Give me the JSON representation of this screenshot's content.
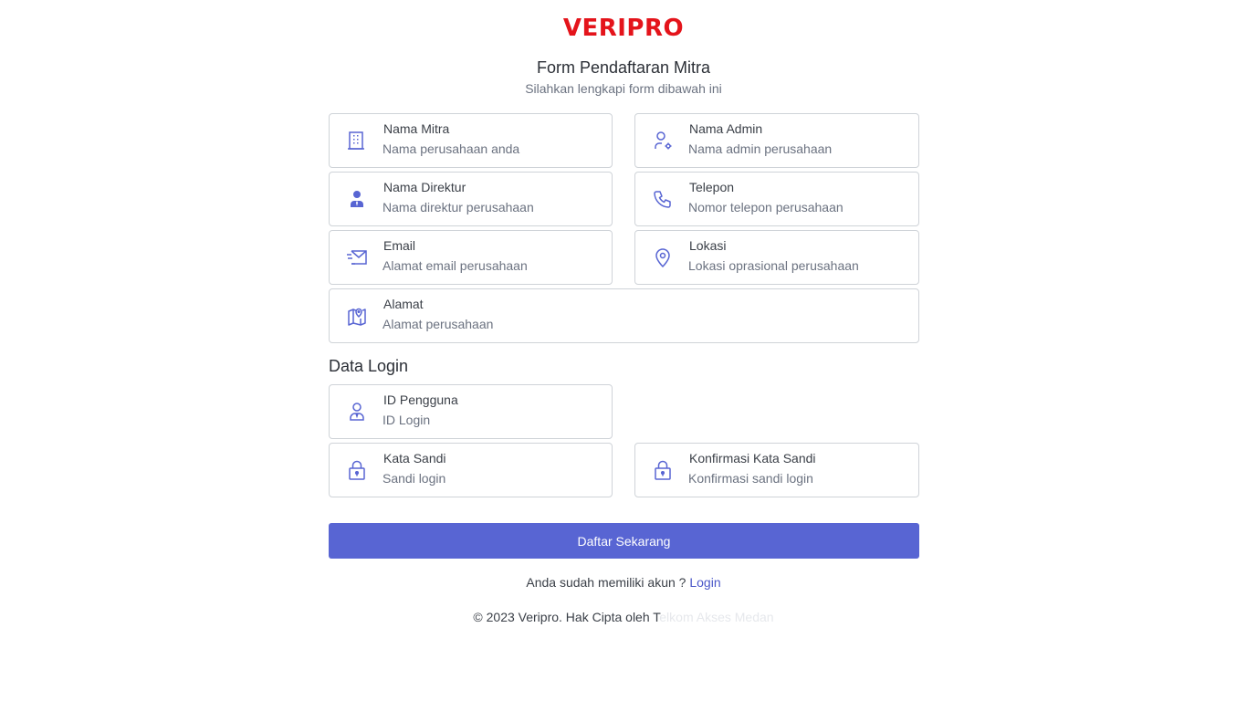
{
  "brand": {
    "logo_text": "VERIPRO",
    "color": "#e4141b"
  },
  "header": {
    "title": "Form Pendaftaran Mitra",
    "subtitle": "Silahkan lengkapi form dibawah ini"
  },
  "fields": {
    "nama_mitra": {
      "label": "Nama Mitra",
      "placeholder": "Nama perusahaan anda",
      "icon": "building-icon"
    },
    "nama_admin": {
      "label": "Nama Admin",
      "placeholder": "Nama admin perusahaan",
      "icon": "user-gear-icon"
    },
    "nama_direktur": {
      "label": "Nama Direktur",
      "placeholder": "Nama direktur perusahaan",
      "icon": "user-tie-icon"
    },
    "telepon": {
      "label": "Telepon",
      "placeholder": "Nomor telepon perusahaan",
      "icon": "phone-icon"
    },
    "email": {
      "label": "Email",
      "placeholder": "Alamat email perusahaan",
      "icon": "mail-fast-icon"
    },
    "lokasi": {
      "label": "Lokasi",
      "placeholder": "Lokasi oprasional perusahaan",
      "icon": "map-pin-icon"
    },
    "alamat": {
      "label": "Alamat",
      "placeholder": "Alamat perusahaan",
      "icon": "map-location-icon"
    }
  },
  "login_section": {
    "title": "Data Login",
    "id_pengguna": {
      "label": "ID Pengguna",
      "placeholder": "ID Login",
      "icon": "user-id-icon"
    },
    "kata_sandi": {
      "label": "Kata Sandi",
      "placeholder": "Sandi login",
      "icon": "lock-icon"
    },
    "konfirmasi": {
      "label": "Konfirmasi Kata Sandi",
      "placeholder": "Konfirmasi sandi login",
      "icon": "lock-icon"
    }
  },
  "submit": {
    "label": "Daftar Sekarang",
    "color": "#5865d3"
  },
  "login_prompt": {
    "text": "Anda sudah memiliki akun ? ",
    "link": "Login"
  },
  "footer": {
    "text": "© 2023 Veripro. Hak Cipta oleh T",
    "faded_text": "elkom Akses Medan"
  },
  "colors": {
    "icon": "#5865d3",
    "border": "#cfd3d8"
  }
}
